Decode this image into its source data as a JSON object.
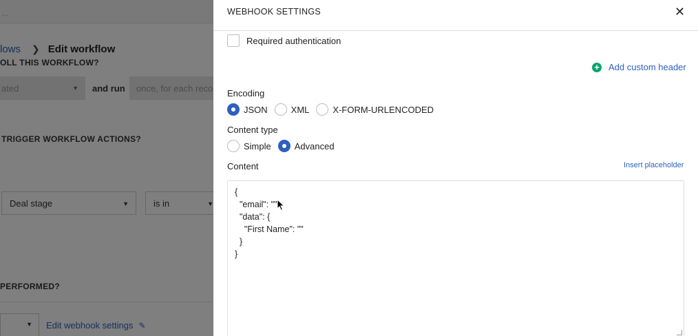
{
  "background": {
    "topbar_text": "...",
    "breadcrumb": {
      "parent": "lows",
      "current": "Edit workflow"
    },
    "question_enroll": "OLL THIS WORKFLOW?",
    "status_select": "ated",
    "and_run": "and run",
    "frequency_select": "once, for each reco",
    "question_trigger": "TRIGGER WORKFLOW ACTIONS?",
    "field_select": "Deal stage",
    "operator_select": "is in",
    "question_performed": "PERFORMED?",
    "edit_webhook_link": "Edit webhook settings"
  },
  "modal": {
    "title": "WEBHOOK SETTINGS",
    "required_auth_label": "Required authentication",
    "required_auth_checked": false,
    "add_custom_header": "Add custom header",
    "encoding": {
      "label": "Encoding",
      "options": [
        "JSON",
        "XML",
        "X-FORM-URLENCODED"
      ],
      "selected": "JSON"
    },
    "content_type": {
      "label": "Content type",
      "options": [
        "Simple",
        "Advanced"
      ],
      "selected": "Advanced"
    },
    "content": {
      "label": "Content",
      "insert_placeholder": "Insert placeholder",
      "text": "{\n  \"email\": \"\",\n  \"data\": {\n    \"First Name\": \"\"\n  }\n}"
    }
  },
  "colors": {
    "accent": "#2d5fbf",
    "add_icon": "#0aa56f",
    "overlay": "rgba(0,0,0,0.5)"
  }
}
